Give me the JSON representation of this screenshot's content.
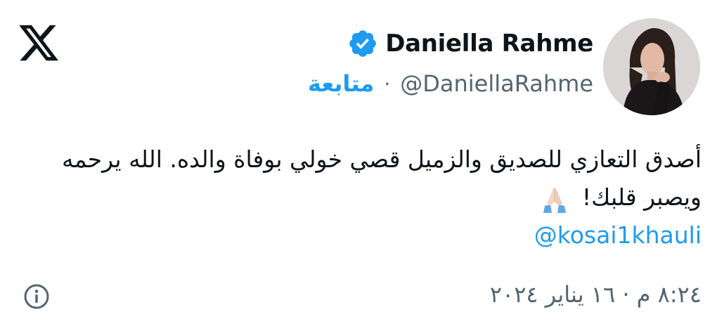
{
  "author": {
    "name": "Daniella Rahme",
    "handle": "@DaniellaRahme",
    "separator": "·",
    "follow_label": "متابعة",
    "verified": true
  },
  "tweet": {
    "text_line1": "أصدق التعازي للصديق والزميل قصي خولي بوفاة والده. الله يرحمه",
    "text_line2": "ويصبر قلبك!",
    "mention": "@kosai1khauli"
  },
  "timestamp": "٨:٢٤ م · ١٦ يناير ٢٠٢٤",
  "icons": {
    "brand": "x-logo-icon",
    "verified": "verified-badge-icon",
    "emoji": "folded-hands-icon",
    "info": "info-icon"
  },
  "colors": {
    "accent": "#1d9bf0",
    "text_primary": "#0f1419",
    "text_secondary": "#536471"
  }
}
